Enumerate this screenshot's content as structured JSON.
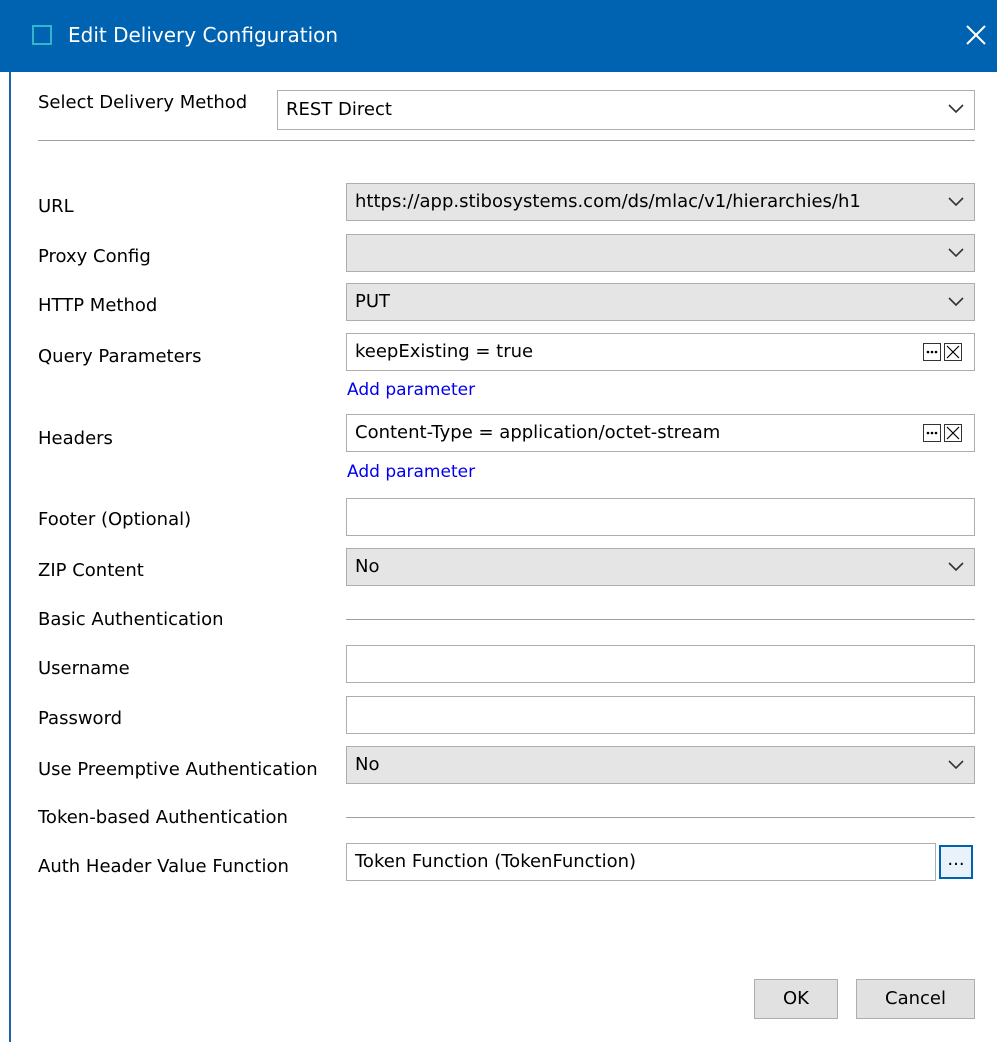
{
  "window": {
    "title": "Edit Delivery Configuration",
    "close_glyph": "✕"
  },
  "delivery_method": {
    "label": "Select Delivery Method",
    "value": "REST Direct"
  },
  "fields": {
    "url": {
      "label": "URL",
      "value": "https://app.stibosystems.com/ds/mlac/v1/hierarchies/h1"
    },
    "proxy_config": {
      "label": "Proxy Config",
      "value": ""
    },
    "http_method": {
      "label": "HTTP Method",
      "value": "PUT"
    },
    "query_parameters": {
      "label": "Query Parameters",
      "value": "keepExisting = true",
      "add_link": "Add parameter"
    },
    "headers": {
      "label": "Headers",
      "value": "Content-Type = application/octet-stream",
      "add_link": "Add parameter"
    },
    "footer": {
      "label": "Footer (Optional)",
      "value": ""
    },
    "zip_content": {
      "label": "ZIP Content",
      "value": "No"
    },
    "basic_auth_section": {
      "label": "Basic Authentication"
    },
    "username": {
      "label": "Username",
      "value": ""
    },
    "password": {
      "label": "Password",
      "value": ""
    },
    "preemptive_auth": {
      "label": "Use Preemptive Authentication",
      "value": "No"
    },
    "token_auth_section": {
      "label": "Token-based Authentication"
    },
    "auth_header_function": {
      "label": "Auth Header Value Function",
      "value": "Token Function (TokenFunction)",
      "browse_label": "..."
    }
  },
  "buttons": {
    "ok": "OK",
    "cancel": "Cancel"
  },
  "colors": {
    "titlebar": "#0063b1",
    "link": "#0000ee"
  }
}
